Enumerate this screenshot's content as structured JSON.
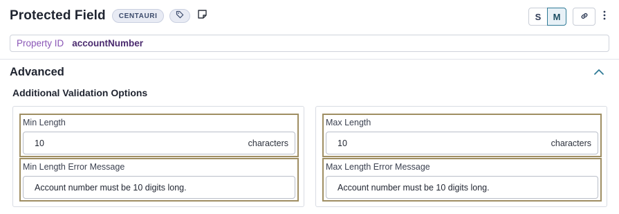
{
  "header": {
    "title": "Protected Field",
    "badge": "CENTAURI",
    "size_options": [
      "S",
      "M"
    ],
    "selected_size": "M"
  },
  "property": {
    "label": "Property ID",
    "value": "accountNumber"
  },
  "advanced": {
    "title": "Advanced",
    "expanded": true,
    "subtitle": "Additional Validation Options",
    "left": {
      "length_label": "Min Length",
      "length_value": "10",
      "length_suffix": "characters",
      "error_label": "Min Length Error Message",
      "error_value": "Account number must be 10 digits long."
    },
    "right": {
      "length_label": "Max Length",
      "length_value": "10",
      "length_suffix": "characters",
      "error_label": "Max Length Error Message",
      "error_value": "Account number must be 10 digits long."
    }
  },
  "icons": {
    "tag": "tag-icon",
    "note": "note-icon",
    "link": "link-icon",
    "more": "kebab-menu-icon",
    "collapse": "chevron-up-icon"
  },
  "colors": {
    "highlight_border": "#9f8e62",
    "property_label": "#8a56b6",
    "property_value": "#4a2a6e",
    "selected_size": "#2f7a96"
  }
}
